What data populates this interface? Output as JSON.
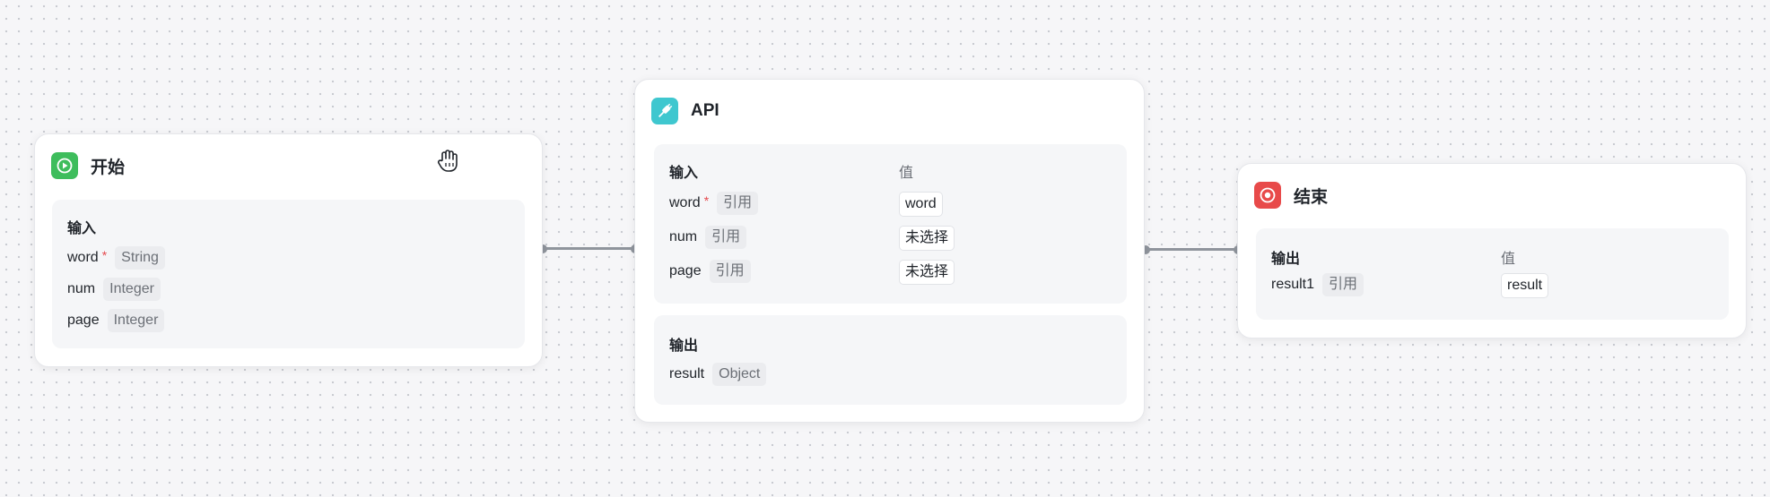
{
  "start": {
    "title": "开始",
    "icon": "play-icon",
    "input_label": "输入",
    "params": [
      {
        "name": "word",
        "required": "*",
        "type": "String"
      },
      {
        "name": "num",
        "type": "Integer"
      },
      {
        "name": "page",
        "type": "Integer"
      }
    ]
  },
  "api": {
    "title": "API",
    "icon": "plug-icon",
    "input_label": "输入",
    "value_label": "值",
    "params": [
      {
        "name": "word",
        "required": "*",
        "type": "引用",
        "value": "word"
      },
      {
        "name": "num",
        "type": "引用",
        "value": "未选择"
      },
      {
        "name": "page",
        "type": "引用",
        "value": "未选择"
      }
    ],
    "output_label": "输出",
    "outputs": [
      {
        "name": "result",
        "type": "Object"
      }
    ]
  },
  "end": {
    "title": "结束",
    "icon": "stop-icon",
    "output_label": "输出",
    "value_label": "值",
    "params": [
      {
        "name": "result1",
        "type": "引用",
        "value": "result"
      }
    ]
  },
  "colors": {
    "start_icon": "#3ebd5c",
    "api_icon": "#3fc7cf",
    "end_icon": "#e84a4a",
    "edge": "#8f949c",
    "required": "#e5484d"
  },
  "cursor": "hand-grab-icon"
}
